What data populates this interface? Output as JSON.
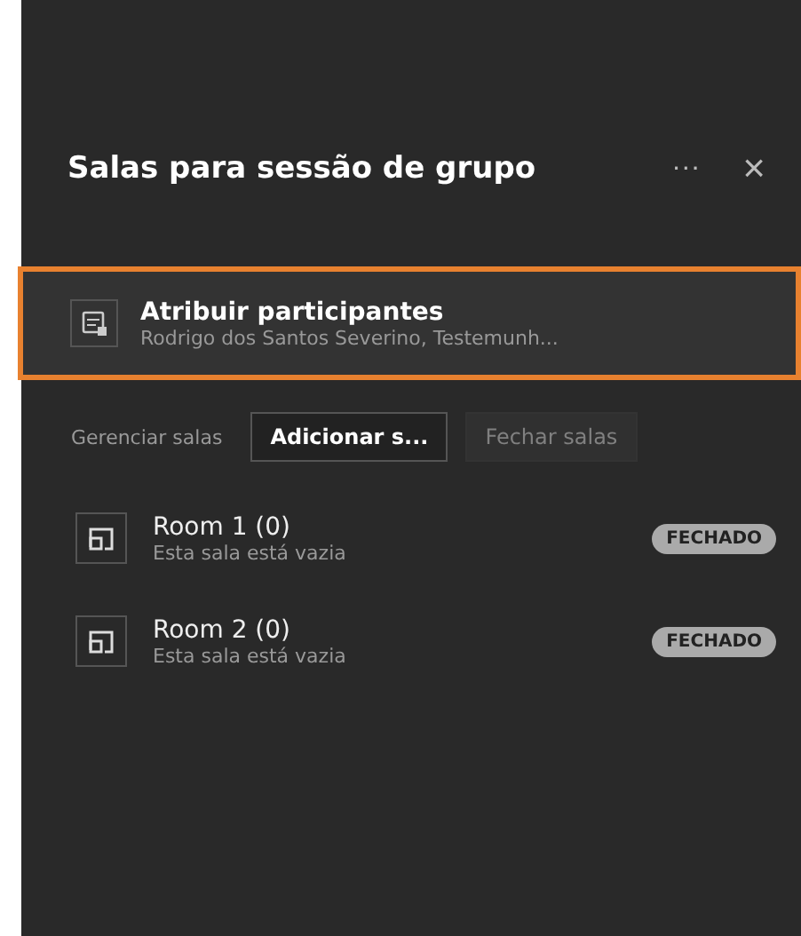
{
  "panel": {
    "title": "Salas para sessão de grupo",
    "more": "···",
    "close": "×"
  },
  "assign": {
    "title": "Atribuir participantes",
    "subtitle": "Rodrigo dos Santos Severino, Testemunh...",
    "highlighted": true
  },
  "manage": {
    "label": "Gerenciar salas",
    "buttons": [
      {
        "label": "Adicionar s...",
        "disabled": false
      },
      {
        "label": "Fechar salas",
        "disabled": true
      }
    ]
  },
  "rooms": [
    {
      "name": "Room 1 (0)",
      "status": "Esta sala está vazia",
      "badge": "FECHADO"
    },
    {
      "name": "Room 2 (0)",
      "status": "Esta sala está vazia",
      "badge": "FECHADO"
    }
  ]
}
